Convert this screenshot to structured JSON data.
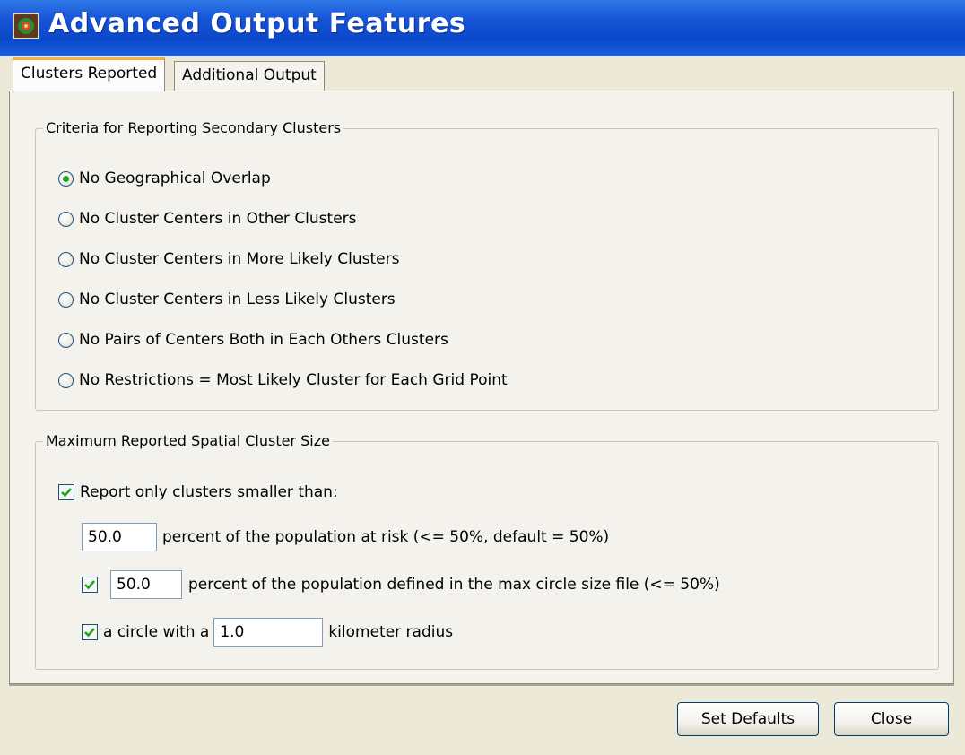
{
  "window": {
    "title": "Advanced Output Features"
  },
  "tabs": [
    {
      "label": "Clusters Reported",
      "active": true
    },
    {
      "label": "Additional Output",
      "active": false
    }
  ],
  "criteria_group": {
    "title": "Criteria for Reporting Secondary Clusters",
    "options": [
      {
        "label": "No Geographical Overlap",
        "checked": true
      },
      {
        "label": "No Cluster Centers in Other Clusters",
        "checked": false
      },
      {
        "label": "No Cluster Centers in More Likely Clusters",
        "checked": false
      },
      {
        "label": "No Cluster Centers in Less Likely Clusters",
        "checked": false
      },
      {
        "label": "No Pairs of Centers Both in Each Others Clusters",
        "checked": false
      },
      {
        "label": "No Restrictions = Most Likely Cluster for Each Grid Point",
        "checked": false
      }
    ]
  },
  "max_size_group": {
    "title": "Maximum Reported Spatial Cluster Size",
    "report_smaller": {
      "label": "Report only clusters smaller than:",
      "checked": true
    },
    "population_risk": {
      "value": "50.0",
      "label": "percent of the population at risk (<= 50%, default = 50%)"
    },
    "max_circle_file": {
      "checked": true,
      "value": "50.0",
      "label": "percent of the population defined in the max circle size file (<= 50%)"
    },
    "circle_radius": {
      "checked": true,
      "prefix": "a circle with a",
      "value": "1.0",
      "suffix": "kilometer radius"
    }
  },
  "buttons": {
    "set_defaults": "Set Defaults",
    "close": "Close"
  },
  "colors": {
    "titlebar": "#0a47c9",
    "tab_accent": "#f5b33d",
    "radio_dot": "#21a121",
    "checkmark": "#21a121"
  }
}
